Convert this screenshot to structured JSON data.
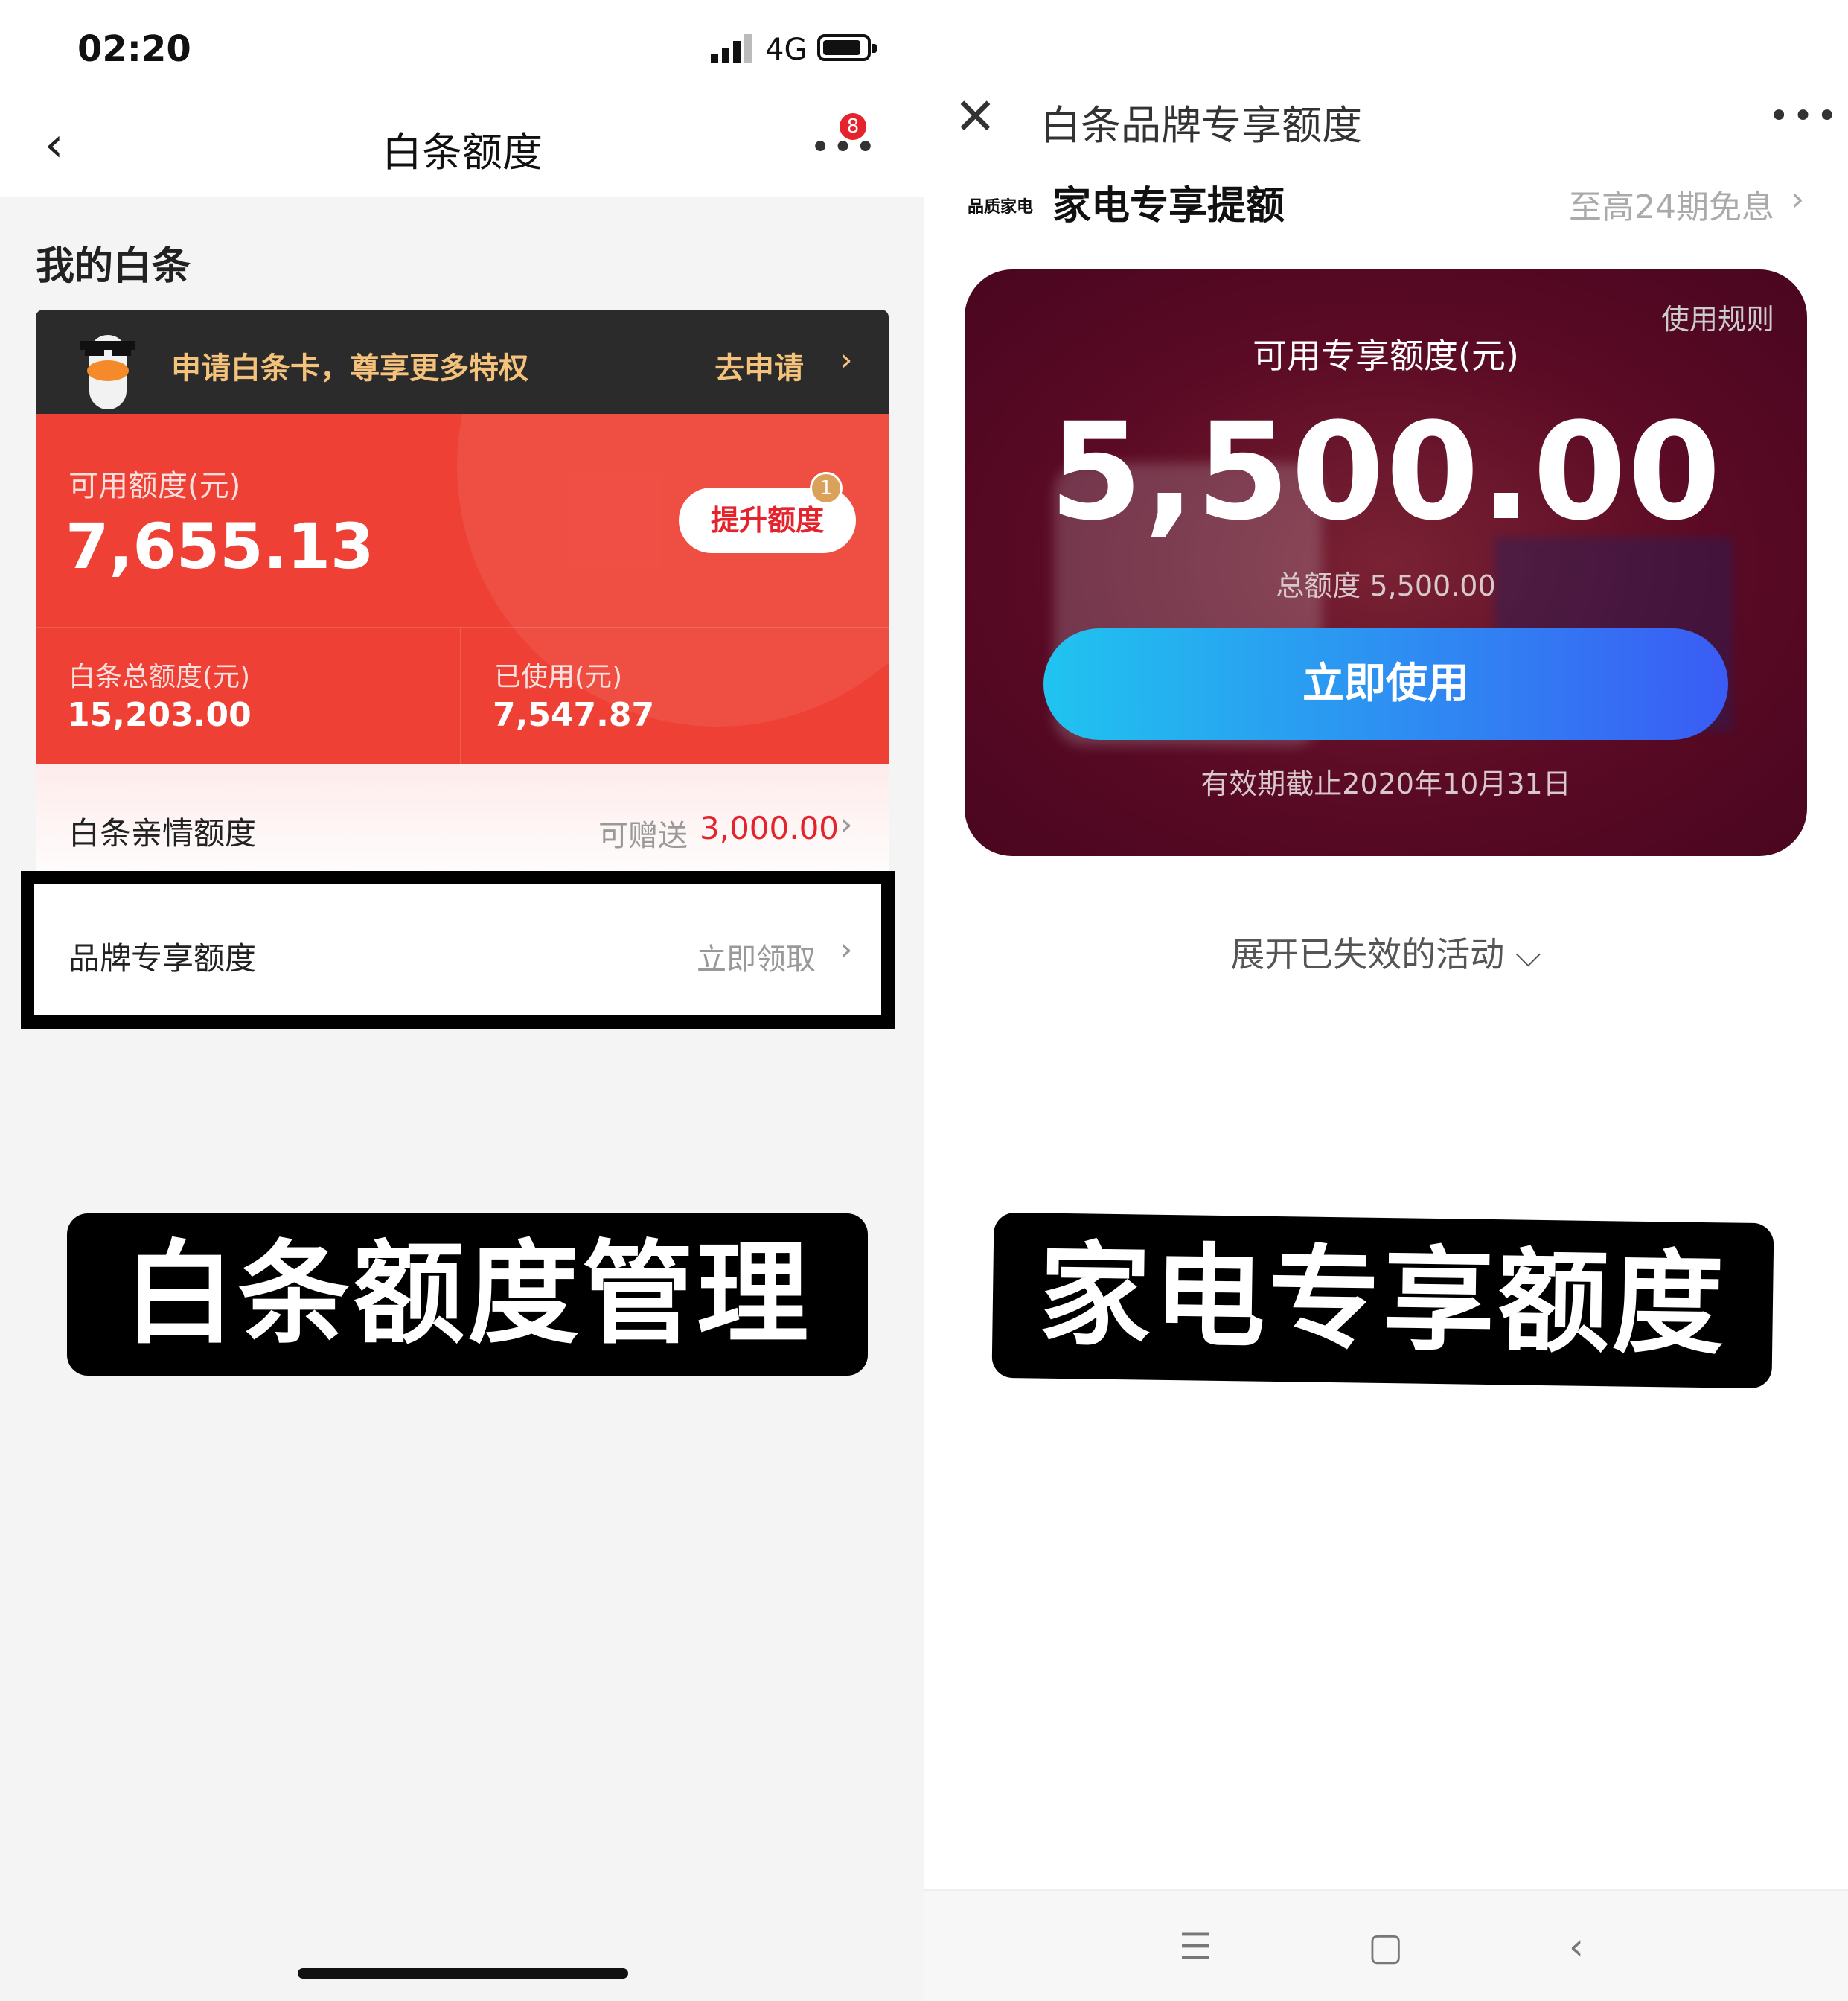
{
  "left": {
    "status": {
      "time": "02:20",
      "network": "4G"
    },
    "nav": {
      "back": "‹",
      "title": "白条额度",
      "more": "•••",
      "badge": "8"
    },
    "section_title": "我的白条",
    "promo": {
      "text": "申请白条卡，尊享更多特权",
      "action": "去申请",
      "arrow": "›"
    },
    "credit": {
      "available_label": "可用额度(元)",
      "available_value": "7,655.13",
      "raise_button": "提升额度",
      "raise_badge": "1",
      "total_label": "白条总额度(元)",
      "total_value": "15,203.00",
      "used_label": "已使用(元)",
      "used_value": "7,547.87"
    },
    "family": {
      "label": "白条亲情额度",
      "gift_label": "可赠送",
      "gift_value": "3,000.00",
      "arrow": "›"
    },
    "brand": {
      "label": "品牌专享额度",
      "action": "立即领取",
      "arrow": "›"
    },
    "caption": "白条额度管理"
  },
  "right": {
    "nav": {
      "close": "✕",
      "title": "白条品牌专享额度",
      "more": "•••"
    },
    "section": {
      "logo_text": "品质家电",
      "title": "家电专享提额",
      "subtitle": "至高24期免息",
      "arrow": "›"
    },
    "card": {
      "rules": "使用规则",
      "label": "可用专享额度(元)",
      "value": "5,500.00",
      "total": "总额度 5,500.00",
      "use_button": "立即使用",
      "validity": "有效期截止2020年10月31日"
    },
    "expand": "展开已失效的活动 ⌵",
    "caption": "家电专享额度",
    "system_nav": {
      "menu": "☰",
      "home": "▢",
      "back": "‹"
    }
  }
}
